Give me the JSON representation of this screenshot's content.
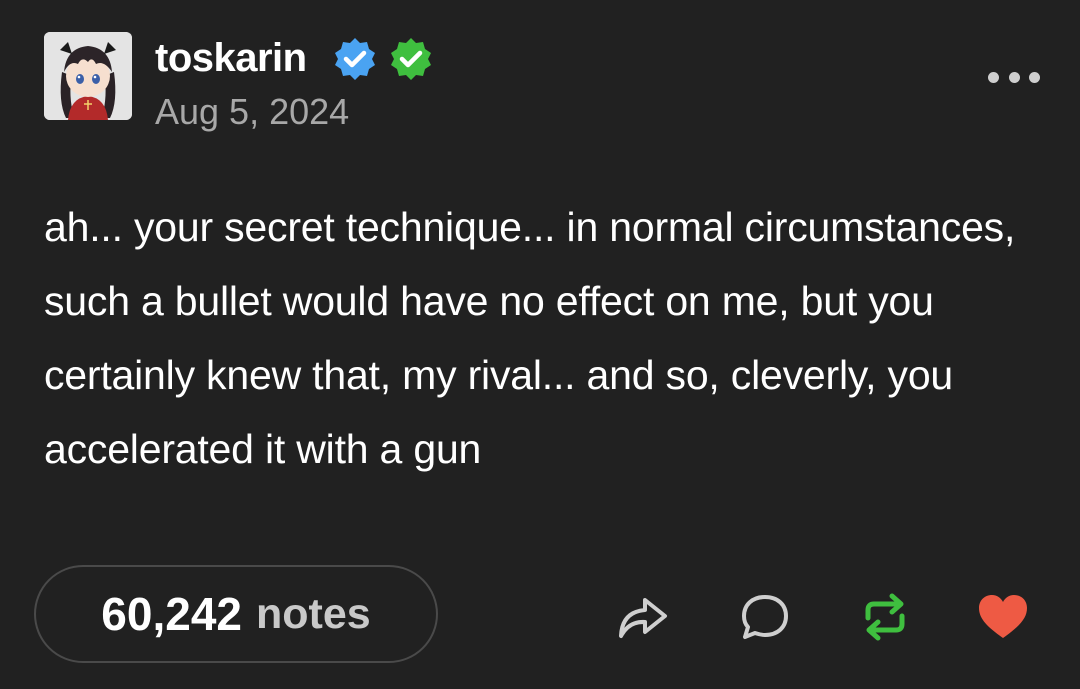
{
  "post": {
    "username": "toskarin",
    "date": "Aug 5, 2024",
    "badges": [
      {
        "icon": "verified-badge-blue-icon",
        "color": "#4aa3f2"
      },
      {
        "icon": "verified-badge-green-icon",
        "color": "#3fbf3f"
      }
    ],
    "body": "ah... your secret technique... in normal circumstances, such a bullet would have no effect on me, but you certainly knew that, my rival... and so, cleverly, you accelerated it with a gun",
    "notes_count": "60,242",
    "notes_label": "notes"
  },
  "actions": {
    "share_icon": "share-arrow-icon",
    "reply_icon": "speech-bubble-icon",
    "reblog_icon": "reblog-icon",
    "like_icon": "heart-icon",
    "reblog_color": "#3fbf3f",
    "like_color": "#ee5a44"
  },
  "theme": {
    "background": "#212121",
    "text": "#ffffff",
    "muted": "#a8a8a8"
  }
}
